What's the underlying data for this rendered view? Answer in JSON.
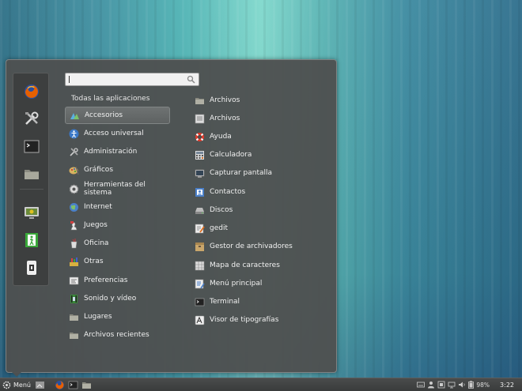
{
  "search": {
    "placeholder": ""
  },
  "categories_header": "Todas las aplicaciones",
  "categories": [
    {
      "label": "Accesorios",
      "icon": "accessories-icon",
      "selected": true
    },
    {
      "label": "Acceso universal",
      "icon": "universal-access-icon"
    },
    {
      "label": "Administración",
      "icon": "administration-icon"
    },
    {
      "label": "Gráficos",
      "icon": "graphics-icon"
    },
    {
      "label": "Herramientas del sistema",
      "icon": "system-tools-icon"
    },
    {
      "label": "Internet",
      "icon": "internet-icon"
    },
    {
      "label": "Juegos",
      "icon": "games-icon"
    },
    {
      "label": "Oficina",
      "icon": "office-icon"
    },
    {
      "label": "Otras",
      "icon": "other-icon"
    },
    {
      "label": "Preferencias",
      "icon": "preferences-icon"
    },
    {
      "label": "Sonido y vídeo",
      "icon": "sound-video-icon"
    },
    {
      "label": "Lugares",
      "icon": "places-folder-icon"
    },
    {
      "label": "Archivos recientes",
      "icon": "recent-files-folder-icon"
    }
  ],
  "apps": [
    {
      "label": "Archivos",
      "icon": "folder-icon"
    },
    {
      "label": "Archivos",
      "icon": "archive-icon"
    },
    {
      "label": "Ayuda",
      "icon": "help-lifebuoy-icon"
    },
    {
      "label": "Calculadora",
      "icon": "calculator-icon"
    },
    {
      "label": "Capturar pantalla",
      "icon": "screenshot-icon"
    },
    {
      "label": "Contactos",
      "icon": "contacts-icon"
    },
    {
      "label": "Discos",
      "icon": "disks-icon"
    },
    {
      "label": "gedit",
      "icon": "gedit-icon"
    },
    {
      "label": "Gestor de archivadores",
      "icon": "archive-manager-icon"
    },
    {
      "label": "Mapa de caracteres",
      "icon": "character-map-icon"
    },
    {
      "label": "Menú principal",
      "icon": "main-menu-icon"
    },
    {
      "label": "Terminal",
      "icon": "terminal-icon"
    },
    {
      "label": "Visor de tipografías",
      "icon": "font-viewer-icon"
    }
  ],
  "favorites": [
    {
      "name": "firefox-icon"
    },
    {
      "name": "system-settings-icon"
    },
    {
      "name": "terminal-icon"
    },
    {
      "name": "files-folder-icon"
    },
    {
      "name": "lock-screen-icon"
    },
    {
      "name": "logout-icon"
    },
    {
      "name": "shutdown-icon"
    }
  ],
  "taskbar": {
    "menu_label": "Menú",
    "battery": "98%",
    "clock": "3:22"
  },
  "colors": {
    "panel_bg": "#4e5050",
    "accent_green": "#4caf50",
    "firefox_orange": "#e66000"
  }
}
